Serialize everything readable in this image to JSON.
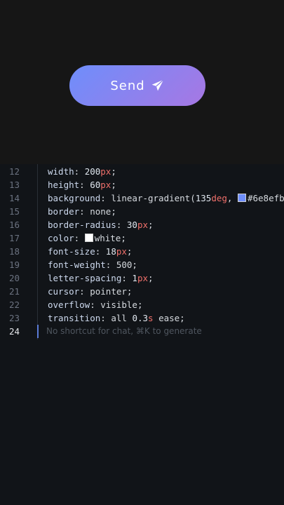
{
  "button": {
    "label": "Send",
    "icon": "paper-plane-icon",
    "gradient_start": "#6e8efb",
    "gradient_end": "#a777e3"
  },
  "editor": {
    "lines": [
      {
        "n": "12",
        "prop": "width",
        "value": "200",
        "unit": "px",
        "end": ";"
      },
      {
        "n": "13",
        "prop": "height",
        "value": "60",
        "unit": "px",
        "end": ";"
      },
      {
        "n": "14",
        "prop": "background",
        "pre": "linear-gradient(",
        "value": "135",
        "unit": "deg",
        "post": ", ",
        "color_text": "#6e8efb",
        "swatch": "#6e8efb"
      },
      {
        "n": "15",
        "prop": "border",
        "text": "none;"
      },
      {
        "n": "16",
        "prop": "border-radius",
        "value": "30",
        "unit": "px",
        "end": ";"
      },
      {
        "n": "17",
        "prop": "color",
        "text": "white;",
        "swatch": "#ffffff"
      },
      {
        "n": "18",
        "prop": "font-size",
        "value": "18",
        "unit": "px",
        "end": ";"
      },
      {
        "n": "19",
        "prop": "font-weight",
        "text": "500;"
      },
      {
        "n": "20",
        "prop": "letter-spacing",
        "value": "1",
        "unit": "px",
        "end": ";"
      },
      {
        "n": "21",
        "prop": "cursor",
        "text": "pointer;"
      },
      {
        "n": "22",
        "prop": "overflow",
        "text": "visible;"
      },
      {
        "n": "23",
        "prop": "transition",
        "pre": "all ",
        "value": "0.3",
        "unit": "s",
        "post": " ease;"
      }
    ],
    "active_line": {
      "n": "24",
      "placeholder": "No shortcut for chat, ⌘K to generate"
    }
  }
}
